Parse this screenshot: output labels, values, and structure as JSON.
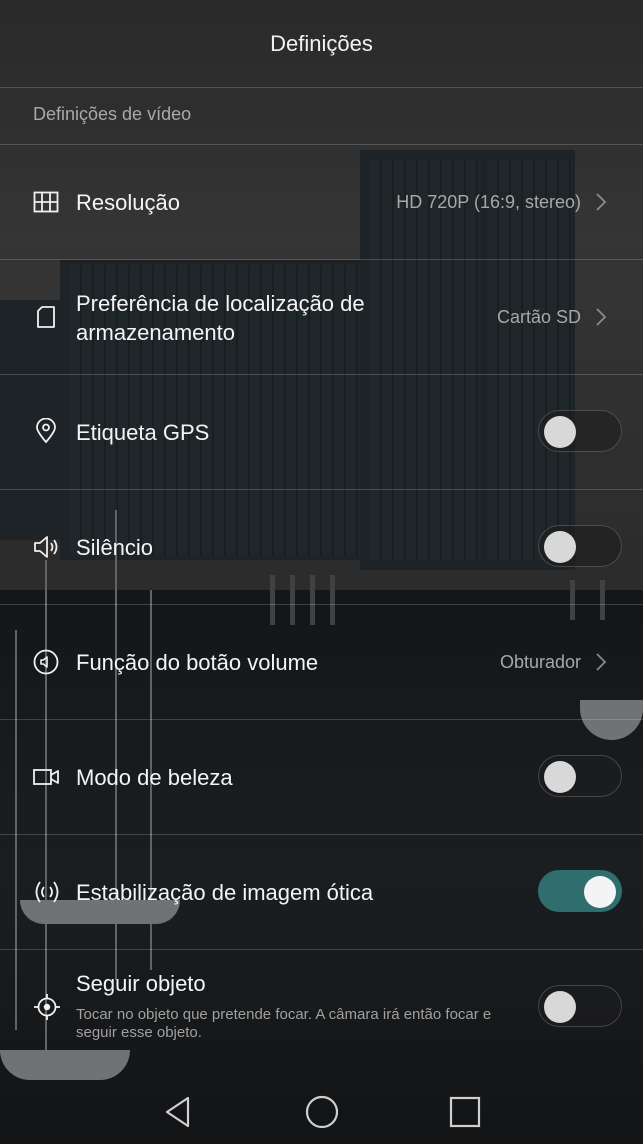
{
  "header": {
    "title": "Definições"
  },
  "section": {
    "title": "Definições de vídeo"
  },
  "rows": [
    {
      "label": "Resolução",
      "value": "HD 720P (16:9, stereo)"
    },
    {
      "label": "Preferência de localização de armazenamento",
      "value": "Cartão SD"
    },
    {
      "label": "Etiqueta GPS",
      "toggle": false
    },
    {
      "label": "Silêncio",
      "toggle": false
    },
    {
      "label": "Função do botão volume",
      "value": "Obturador"
    },
    {
      "label": "Modo de beleza",
      "toggle": false
    },
    {
      "label": "Estabilização de imagem ótica",
      "toggle": true
    },
    {
      "label": "Seguir objeto",
      "sub": "Tocar no objeto que pretende focar. A câmara irá então focar e seguir esse objeto.",
      "toggle": false
    }
  ],
  "nav": {
    "back": "back-icon",
    "home": "home-icon",
    "recents": "recents-icon"
  },
  "colors": {
    "toggle_on": "#2e6f6d",
    "text": "#f4f4f4",
    "secondary": "#a8a8a8"
  }
}
